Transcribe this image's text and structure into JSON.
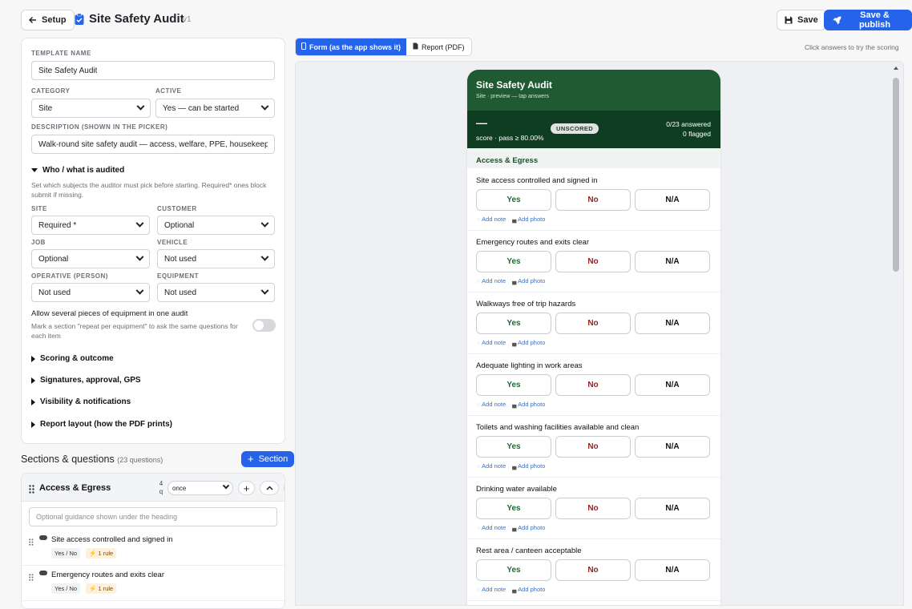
{
  "header": {
    "back_label": "Setup",
    "title": "Site Safety Audit",
    "version": "v1",
    "save_label": "Save",
    "publish_label": "Save & publish"
  },
  "left": {
    "template_name_label": "TEMPLATE NAME",
    "template_name": "Site Safety Audit",
    "category_label": "CATEGORY",
    "category": "Site",
    "active_label": "ACTIVE",
    "active": "Yes — can be started",
    "description_label": "DESCRIPTION (SHOWN IN THE PICKER)",
    "description": "Walk-round site safety audit — access, welfare, PPE, housekeeping",
    "who_heading": "Who / what is audited",
    "who_help": "Set which subjects the auditor must pick before starting. Required* ones block submit if missing.",
    "subjects": [
      {
        "label": "SITE",
        "value": "Required *"
      },
      {
        "label": "CUSTOMER",
        "value": "Optional"
      },
      {
        "label": "JOB",
        "value": "Optional"
      },
      {
        "label": "VEHICLE",
        "value": "Not used"
      },
      {
        "label": "OPERATIVE (PERSON)",
        "value": "Not used"
      },
      {
        "label": "EQUIPMENT",
        "value": "Not used"
      }
    ],
    "multi_equipment_label": "Allow several pieces of equipment in one audit",
    "multi_equipment_help": "Mark a section \"repeat per equipment\" to ask the same questions for each item",
    "multi_equipment_on": false,
    "collapsibles": [
      "Scoring & outcome",
      "Signatures, approval, GPS",
      "Visibility & notifications",
      "Report layout (how the PDF prints)"
    ]
  },
  "sections": {
    "title": "Sections & questions",
    "count": "(23 questions)",
    "add_label": "Section",
    "first": {
      "name": "Access & Egress",
      "q_count_num": "4",
      "q_count_unit": "q",
      "repeat": "once",
      "guidance_placeholder": "Optional guidance shown under the heading",
      "questions": [
        {
          "text": "Site access controlled and signed in",
          "type": "Yes / No",
          "rule": "1 rule"
        },
        {
          "text": "Emergency routes and exits clear",
          "type": "Yes / No",
          "rule": "1 rule"
        }
      ]
    }
  },
  "tabs": {
    "form": "Form (as the app shows it)",
    "report": "Report (PDF)",
    "hint": "Click answers to try the scoring"
  },
  "phone": {
    "title": "Site Safety Audit",
    "subtitle": "Site · preview — tap answers",
    "score_value": "—",
    "score_label": "score · pass ≥ 80.00%",
    "badge": "UNSCORED",
    "answered": "0/23 answered",
    "flagged": "0 flagged",
    "section": "Access & Egress",
    "answers": {
      "yes": "Yes",
      "no": "No",
      "na": "N/A"
    },
    "add_note": "Add note",
    "add_photo": "Add photo",
    "questions": [
      "Site access controlled and signed in",
      "Emergency routes and exits clear",
      "Walkways free of trip hazards",
      "Adequate lighting in work areas",
      "Toilets and washing facilities available and clean",
      "Drinking water available",
      "Rest area / canteen acceptable"
    ]
  },
  "colors": {
    "accent": "#2563eb",
    "header_green": "#1f5a32",
    "score_green": "#0f3d22",
    "yes": "#1e6b34",
    "no": "#9b1c1c"
  }
}
